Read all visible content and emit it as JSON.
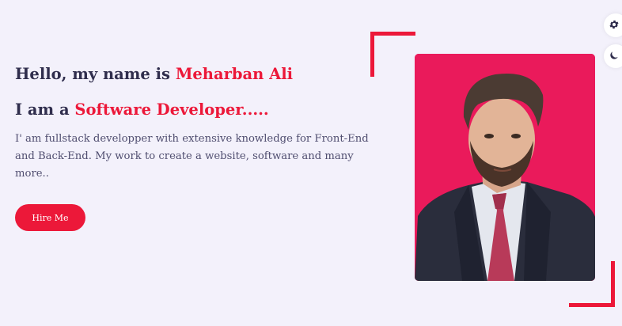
{
  "hero": {
    "greeting_prefix": "Hello, my name is ",
    "name": "Meharban Ali",
    "role_prefix": "I am a ",
    "role": "Software Developer.....",
    "description": "I' am fullstack developper with extensive knowledge for Front-End and Back-End. My work to create a website, software and many more..",
    "hire_button": "Hire Me"
  },
  "style_switcher": {
    "settings_icon": "gear-icon",
    "theme_icon": "moon-icon"
  },
  "colors": {
    "accent": "#ec1839",
    "text": "#302e4d",
    "background": "#f3f1fb",
    "photo_background": "#ea1a5b"
  }
}
